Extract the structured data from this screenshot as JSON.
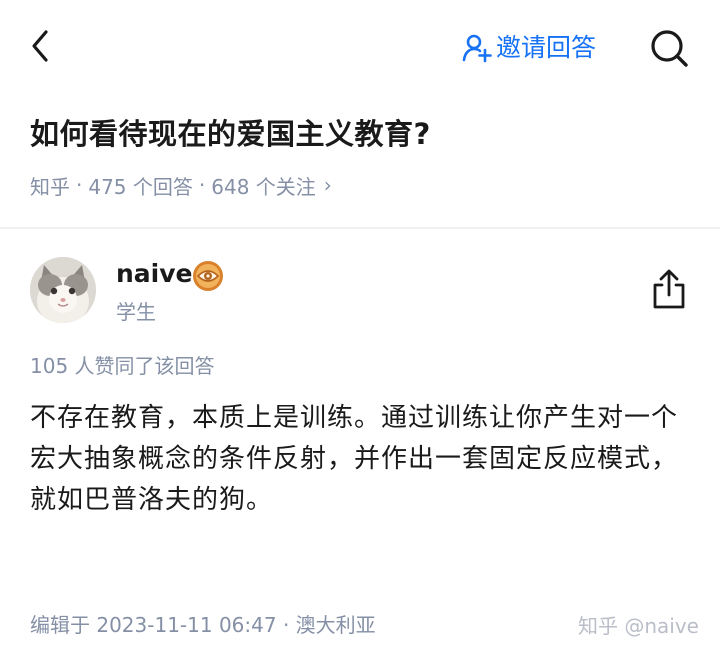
{
  "header": {
    "invite_label": "邀请回答"
  },
  "question": {
    "title": "如何看待现在的爱国主义教育?",
    "source": "知乎",
    "answers": "475 个回答",
    "follows": "648 个关注",
    "separator": "·",
    "chevron": "›"
  },
  "answer": {
    "author_name": "naive",
    "author_bio": "学生",
    "votes_text": "105 人赞同了该回答",
    "content": "不存在教育，本质上是训练。通过训练让你产生对一个宏大抽象概念的条件反射，并作出一套固定反应模式，就如巴普洛夫的狗。",
    "edit_info": "编辑于 2023-11-11 06:47 · 澳大利亚"
  },
  "watermark": "知乎 @naive",
  "icons": {
    "back": "back-arrow-icon",
    "invite": "person-add-icon",
    "search": "search-icon",
    "badge": "eye-badge-icon",
    "share": "share-icon"
  },
  "colors": {
    "accent": "#1772f6",
    "meta_gray": "#8590a6",
    "badge_orange": "#d9822b"
  }
}
